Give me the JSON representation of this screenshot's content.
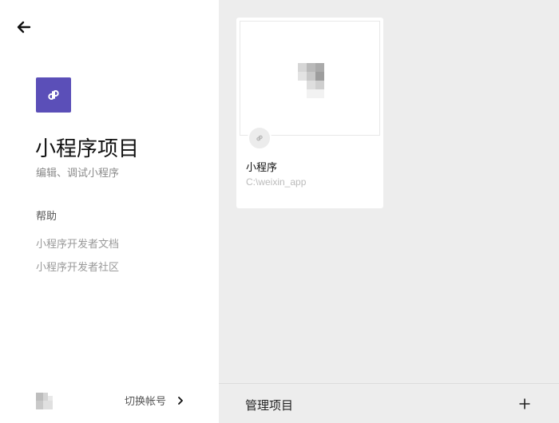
{
  "left": {
    "back_icon": "arrow-left-icon",
    "app_icon": "link-icon",
    "colors": {
      "app_icon_bg": "#5b4fb8"
    },
    "title": "小程序项目",
    "subtitle": "编辑、调试小程序",
    "help": {
      "heading": "帮助",
      "links": [
        "小程序开发者文档",
        "小程序开发者社区"
      ]
    },
    "switch_account_label": "切换帐号"
  },
  "project_card": {
    "name": "小程序",
    "path": "C:\\weixin_app",
    "badge_icon": "link-icon"
  },
  "footer": {
    "manage_label": "管理项目",
    "add_icon": "plus-icon"
  }
}
